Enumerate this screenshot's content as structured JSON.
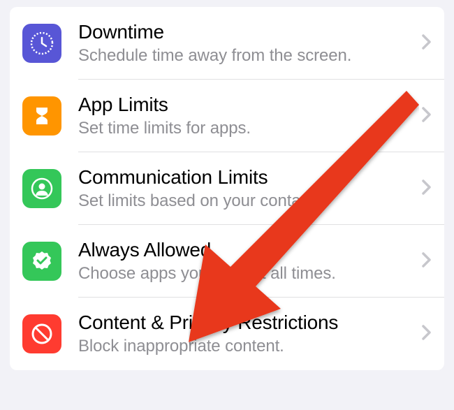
{
  "items": [
    {
      "title": "Downtime",
      "subtitle": "Schedule time away from the screen.",
      "icon": "clock-icon",
      "color": "purple"
    },
    {
      "title": "App Limits",
      "subtitle": "Set time limits for apps.",
      "icon": "hourglass-icon",
      "color": "orange"
    },
    {
      "title": "Communication Limits",
      "subtitle": "Set limits based on your contacts.",
      "icon": "contact-icon",
      "color": "green"
    },
    {
      "title": "Always Allowed",
      "subtitle": "Choose apps you want at all times.",
      "icon": "check-badge-icon",
      "color": "green"
    },
    {
      "title": "Content & Privacy Restrictions",
      "subtitle": "Block inappropriate content.",
      "icon": "no-entry-icon",
      "color": "red"
    }
  ]
}
